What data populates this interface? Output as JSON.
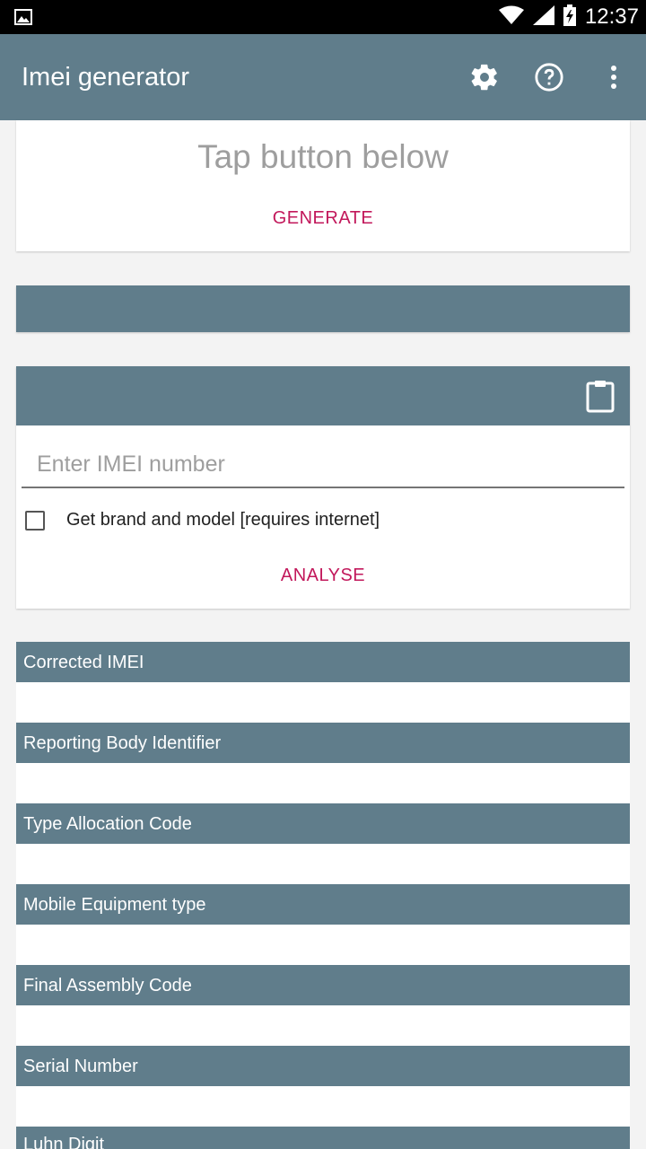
{
  "status_bar": {
    "time": "12:37",
    "icons": [
      "image-icon",
      "wifi-icon",
      "signal-icon",
      "battery-charging-icon"
    ]
  },
  "app_bar": {
    "title": "Imei generator",
    "actions": [
      "settings-icon",
      "help-icon",
      "more-vert-icon"
    ]
  },
  "generate_card": {
    "headline": "Tap button below",
    "button_label": "GENERATE"
  },
  "analyse_card": {
    "input_placeholder": "Enter IMEI number",
    "checkbox_label": "Get brand and model [requires internet]",
    "checkbox_checked": false,
    "button_label": "ANALYSE"
  },
  "results": {
    "fields": [
      {
        "label": "Corrected IMEI",
        "value": ""
      },
      {
        "label": "Reporting Body Identifier",
        "value": ""
      },
      {
        "label": "Type Allocation Code",
        "value": ""
      },
      {
        "label": "Mobile Equipment type",
        "value": ""
      },
      {
        "label": "Final Assembly Code",
        "value": ""
      },
      {
        "label": "Serial Number",
        "value": ""
      },
      {
        "label": "Luhn Digit",
        "value": ""
      }
    ]
  },
  "colors": {
    "primary": "#607d8b",
    "accent": "#c2185b"
  }
}
